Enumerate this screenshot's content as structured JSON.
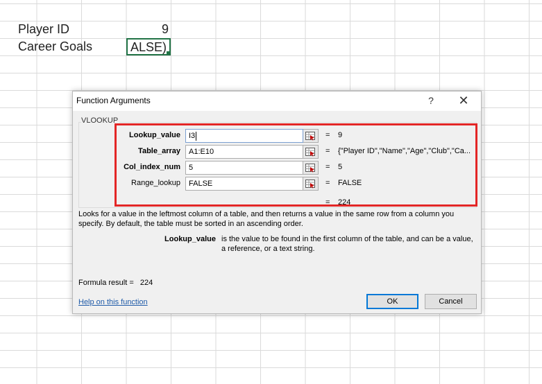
{
  "sheet": {
    "label_player_id": "Player ID",
    "value_player_id": "9",
    "label_career_goals": "Career Goals",
    "active_cell_text": "ALSE)"
  },
  "dialog": {
    "title": "Function Arguments",
    "help_glyph": "?",
    "close_glyph": "✕",
    "function_name": "VLOOKUP",
    "args": [
      {
        "label": "Lookup_value",
        "bold": true,
        "input": "I3",
        "value": "9"
      },
      {
        "label": "Table_array",
        "bold": true,
        "input": "A1:E10",
        "value": "{\"Player ID\",\"Name\",\"Age\",\"Club\",\"Ca..."
      },
      {
        "label": "Col_index_num",
        "bold": true,
        "input": "5",
        "value": "5"
      },
      {
        "label": "Range_lookup",
        "bold": false,
        "input": "FALSE",
        "value": "FALSE"
      }
    ],
    "equals": "=",
    "result_value": "224",
    "description": "Looks for a value in the leftmost column of a table, and then returns a value in the same row from a column you specify. By default, the table must be sorted in an ascending order.",
    "arg_help_name": "Lookup_value",
    "arg_help_text": "is the value to be found in the first column of the table, and can be a value, a reference, or a text string.",
    "formula_result_label": "Formula result =",
    "formula_result_value": "224",
    "help_link": "Help on this function",
    "ok_label": "OK",
    "cancel_label": "Cancel"
  },
  "colors": {
    "highlight": "#e32626",
    "link": "#1e5aa8",
    "excel_green": "#217346"
  }
}
